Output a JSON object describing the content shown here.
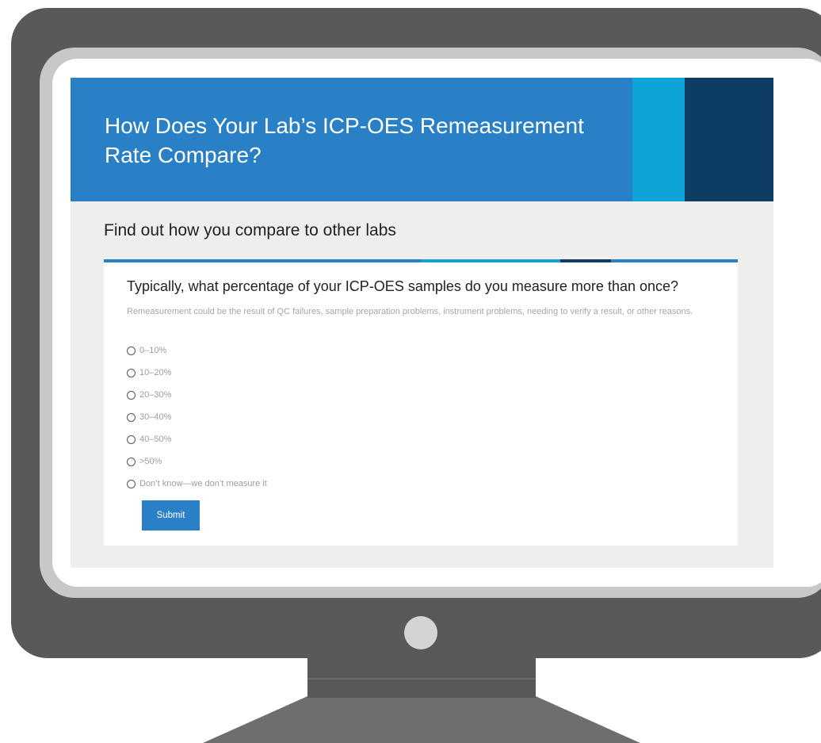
{
  "page": {
    "title": "How Does Your Lab’s ICP-OES Remeasurement Rate Compare?",
    "subtitle": "Find out how you compare to other labs"
  },
  "survey": {
    "question": "Typically, what percentage of your ICP-OES samples do you measure more than once?",
    "help_text": "Remeasurement could be the result of QC failures, sample preparation problems, instrument problems, needing to verify a result, or other reasons.",
    "options": [
      {
        "label": "0–10%"
      },
      {
        "label": "10–20%"
      },
      {
        "label": "20–30%"
      },
      {
        "label": "30–40%"
      },
      {
        "label": "40–50%"
      },
      {
        "label": ">50%"
      },
      {
        "label": "Don’t know—we don’t measure it"
      }
    ],
    "submit_label": "Submit"
  },
  "colors": {
    "brand_blue": "#2980c6",
    "accent_light_blue": "#0ea4da",
    "accent_dark_navy": "#0d3d63",
    "monitor_gray": "#58595b"
  }
}
